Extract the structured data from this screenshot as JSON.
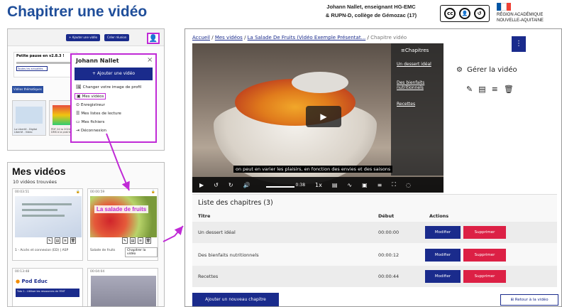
{
  "header": {
    "title": "Chapitrer une vidéo",
    "author_line1": "Johann Nallet, enseignant HG-EMC",
    "author_line2": "& RUPN-D, collège de Gémozac (17)",
    "license": {
      "cc": "cc",
      "by": "BY",
      "sa": "SA"
    },
    "region_line1": "RÉGION ACADÉMIQUE",
    "region_line2": "NOUVELLE-AQUITAINE",
    "flag_colors": [
      "#0055a4",
      "#ffffff",
      "#ef4135"
    ]
  },
  "panel_top": {
    "navbar_buttons": [
      "+ Ajouter une vidéo",
      "Créer réunion"
    ],
    "news_title": "Petite pause en v2.8.3 !",
    "news_button": "Toutes les actualités",
    "tag": "Vidéos thématiques",
    "thumb_caption_1": "La Liberté - Digital Liberté - Video",
    "thumb_caption_2": "PDF 24 to 2024 - DMS à la prairie"
  },
  "user_menu": {
    "name": "Johann Nallet",
    "close": "×",
    "add_video": "+ Ajouter une vidéo",
    "items": [
      {
        "icon": "image-icon",
        "label": "Changer votre image de profil"
      },
      {
        "icon": "video-icon",
        "label": "Mes vidéos"
      },
      {
        "icon": "record-icon",
        "label": "Enregistreur"
      },
      {
        "icon": "playlist-icon",
        "label": "Mes listes de lecture"
      },
      {
        "icon": "folder-icon",
        "label": "Mes fichiers"
      },
      {
        "icon": "logout-icon",
        "label": "Déconnexion"
      }
    ]
  },
  "my_videos": {
    "title": "Mes vidéos",
    "count": "10 vidéos trouvées",
    "cards": [
      {
        "duration": "00:03:51",
        "caption": "1 - Accès et connexion (ED) | ASP"
      },
      {
        "duration": "00:00:59",
        "overlay": "La salade de fruits",
        "caption": "Salade de fruits",
        "tooltip": "Chapitrer la vidéo"
      },
      {
        "duration": "00:13:48",
        "brand": "Pod Educ",
        "tile": "Tuto 1 - Utiliser les ressources de l'ENT"
      },
      {
        "duration": "00:04:04"
      }
    ]
  },
  "main": {
    "breadcrumb": {
      "home": "Accueil",
      "my_videos": "Mes vidéos",
      "video": "La Salade De Fruits (Vidéo Exemple Présentat...",
      "current": "Chapitre vidéo",
      "sep": "/"
    },
    "player": {
      "chapters_header": "≡Chapitres",
      "chapters": [
        "Un dessert idéal",
        "Des bienfaits nutritionnels",
        "Recettes"
      ],
      "subtitle": "on peut en varier les plaisirs, en fonction des envies et des saisons",
      "time": "0:38",
      "speed": "1x"
    },
    "manage": {
      "menu_button": "⋮",
      "title": "Gérer la vidéo"
    },
    "chapter_list": {
      "title": "Liste des chapitres (3)",
      "columns": [
        "Titre",
        "Début",
        "Actions"
      ],
      "rows": [
        {
          "title": "Un dessert idéal",
          "start": "00:00:00"
        },
        {
          "title": "Des bienfaits nutritionnels",
          "start": "00:00:12"
        },
        {
          "title": "Recettes",
          "start": "00:00:44"
        }
      ],
      "modify": "Modifier",
      "delete": "Supprimer"
    },
    "add_chapter": "Ajouter un nouveau chapitre",
    "back_to_video": "Retour à la vidéo"
  },
  "accent_color": "#c02ad6",
  "primary_color": "#1a2b8c",
  "danger_color": "#dc2045"
}
